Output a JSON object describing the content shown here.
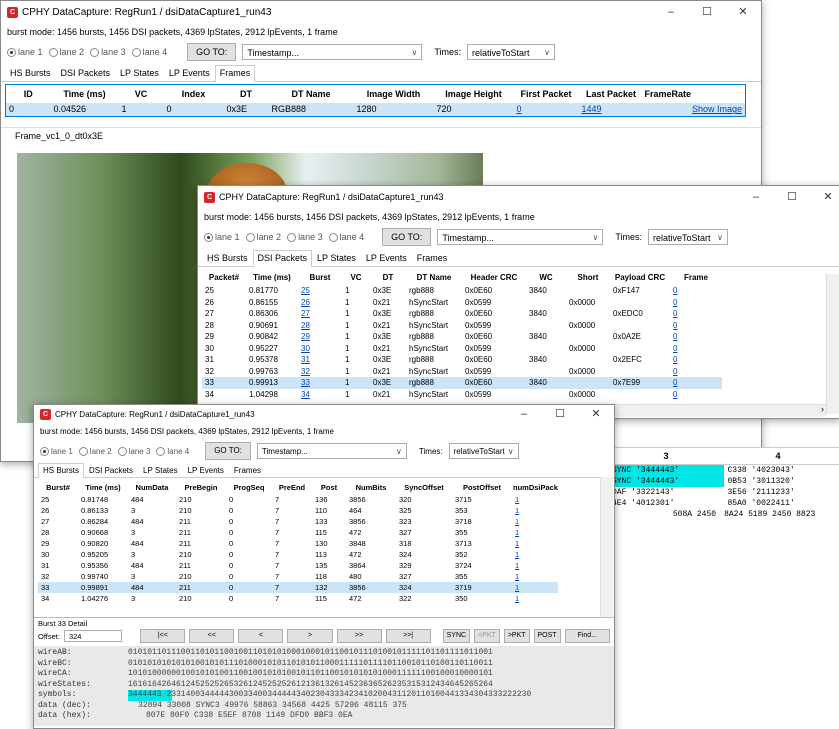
{
  "colors": {
    "accent": "#0078d7",
    "selected_row": "#cce4f7",
    "hex_highlight": "#00e5e5",
    "title_icon": "#d6252c"
  },
  "win1": {
    "title": "CPHY DataCapture: RegRun1 / dsiDataCapture1_run43",
    "summary": "burst mode: 1456 bursts, 1456 DSI packets, 4369 lpStates, 2912 lpEvents, 1 frame",
    "lanes": [
      "lane 1",
      "lane 2",
      "lane 3",
      "lane 4"
    ],
    "goto_label": "GO TO:",
    "goto_value": "Timestamp...",
    "times_label": "Times:",
    "times_value": "relativeToStart",
    "tabs": [
      "HS Bursts",
      "DSI Packets",
      "LP States",
      "LP Events",
      "Frames"
    ],
    "table": {
      "headers": [
        "ID",
        "Time (ms)",
        "VC",
        "Index",
        "DT",
        "DT Name",
        "Image Width",
        "Image Height",
        "First Packet",
        "Last Packet",
        "FrameRate"
      ],
      "row": [
        "0",
        "0.04526",
        "1",
        "0",
        "0x3E",
        "RGB888",
        "1280",
        "720",
        "0",
        "1449",
        ""
      ],
      "show_image": "Show Image"
    },
    "frame_label": "Frame_vc1_0_dt0x3E"
  },
  "win2": {
    "title": "CPHY DataCapture: RegRun1 / dsiDataCapture1_run43",
    "summary": "burst mode: 1456 bursts, 1456 DSI packets, 4369 lpStates, 2912 lpEvents, 1 frame",
    "lanes": [
      "lane 1",
      "lane 2",
      "lane 3",
      "lane 4"
    ],
    "goto_label": "GO TO:",
    "goto_value": "Timestamp...",
    "times_label": "Times:",
    "times_value": "relativeToStart",
    "tabs": [
      "HS Bursts",
      "DSI Packets",
      "LP States",
      "LP Events",
      "Frames"
    ],
    "headers": [
      "Packet#",
      "Time (ms)",
      "Burst",
      "VC",
      "DT",
      "DT Name",
      "Header CRC",
      "WC",
      "Short",
      "Payload CRC",
      "Frame"
    ],
    "rows": [
      [
        "25",
        "0.81770",
        "25",
        "1",
        "0x3E",
        "rgb888",
        "0x0E60",
        "3840",
        "",
        "0xF147",
        "0"
      ],
      [
        "26",
        "0.86155",
        "26",
        "1",
        "0x21",
        "hSyncStart",
        "0x0599",
        "",
        "0x0000",
        "",
        "0"
      ],
      [
        "27",
        "0.86306",
        "27",
        "1",
        "0x3E",
        "rgb888",
        "0x0E60",
        "3840",
        "",
        "0xEDC0",
        "0"
      ],
      [
        "28",
        "0.90691",
        "28",
        "1",
        "0x21",
        "hSyncStart",
        "0x0599",
        "",
        "0x0000",
        "",
        "0"
      ],
      [
        "29",
        "0.90842",
        "29",
        "1",
        "0x3E",
        "rgb888",
        "0x0E60",
        "3840",
        "",
        "0x0A2E",
        "0"
      ],
      [
        "30",
        "0.95227",
        "30",
        "1",
        "0x21",
        "hSyncStart",
        "0x0599",
        "",
        "0x0000",
        "",
        "0"
      ],
      [
        "31",
        "0.95378",
        "31",
        "1",
        "0x3E",
        "rgb888",
        "0x0E60",
        "3840",
        "",
        "0x2EFC",
        "0"
      ],
      [
        "32",
        "0.99763",
        "32",
        "1",
        "0x21",
        "hSyncStart",
        "0x0599",
        "",
        "0x0000",
        "",
        "0"
      ],
      [
        "33",
        "0.99913",
        "33",
        "1",
        "0x3E",
        "rgb888",
        "0x0E60",
        "3840",
        "",
        "0x7E99",
        "0"
      ],
      [
        "34",
        "1.04298",
        "34",
        "1",
        "0x21",
        "hSyncStart",
        "0x0599",
        "",
        "0x0000",
        "",
        "0"
      ]
    ],
    "selected_index": 8
  },
  "win3": {
    "title": "CPHY DataCapture: RegRun1 / dsiDataCapture1_run43",
    "summary": "burst mode: 1456 bursts, 1456 DSI packets, 4369 lpStates, 2912 lpEvents, 1 frame",
    "lanes": [
      "lane 1",
      "lane 2",
      "lane 3",
      "lane 4"
    ],
    "goto_label": "GO TO:",
    "goto_value": "Timestamp...",
    "times_label": "Times:",
    "times_value": "relativeToStart",
    "tabs": [
      "HS Bursts",
      "DSI Packets",
      "LP States",
      "LP Events",
      "Frames"
    ],
    "headers": [
      "Burst#",
      "Time (ms)",
      "NumData",
      "PreBegin",
      "ProgSeq",
      "PreEnd",
      "Post",
      "NumBits",
      "SyncOffset",
      "PostOffset",
      "numDsiPackets"
    ],
    "rows": [
      [
        "25",
        "0.81748",
        "484",
        "210",
        "0",
        "7",
        "136",
        "3856",
        "320",
        "3715",
        "1"
      ],
      [
        "26",
        "0.86133",
        "3",
        "210",
        "0",
        "7",
        "110",
        "464",
        "325",
        "353",
        "1"
      ],
      [
        "27",
        "0.86284",
        "484",
        "211",
        "0",
        "7",
        "133",
        "3856",
        "323",
        "3718",
        "1"
      ],
      [
        "28",
        "0.90668",
        "3",
        "211",
        "0",
        "7",
        "115",
        "472",
        "327",
        "355",
        "1"
      ],
      [
        "29",
        "0.90820",
        "484",
        "211",
        "0",
        "7",
        "130",
        "3848",
        "318",
        "3713",
        "1"
      ],
      [
        "30",
        "0.95205",
        "3",
        "210",
        "0",
        "7",
        "113",
        "472",
        "324",
        "352",
        "1"
      ],
      [
        "31",
        "0.95356",
        "484",
        "211",
        "0",
        "7",
        "135",
        "3864",
        "329",
        "3724",
        "1"
      ],
      [
        "32",
        "0.99740",
        "3",
        "210",
        "0",
        "7",
        "118",
        "480",
        "327",
        "355",
        "1"
      ],
      [
        "33",
        "0.99891",
        "484",
        "211",
        "0",
        "7",
        "132",
        "3856",
        "324",
        "3719",
        "1"
      ],
      [
        "34",
        "1.04276",
        "3",
        "210",
        "0",
        "7",
        "115",
        "472",
        "322",
        "350",
        "1"
      ]
    ],
    "selected_index": 8,
    "detail": {
      "title": "Burst 33 Detail",
      "offset_label": "Offset:",
      "offset_value": "324",
      "nav": [
        "|<<",
        "<<",
        "<",
        ">",
        ">>",
        ">>|"
      ],
      "buttons": [
        "SYNC",
        "<PKT",
        ">PKT",
        "POST",
        "Find..."
      ],
      "labels": [
        "wireAB:",
        "wireBC:",
        "wireCA:",
        "wireStates:",
        "symbols:",
        "data (dec):",
        "data (hex):"
      ],
      "values": [
        "0101011011100110101100100110101010001000101100101110100101111101101111011001",
        "0101010101010100101011101000101011010101100011111011110110010110100110110011",
        "1010100000010010101001100100101010010110110010101010100011111100100010000101",
        "1616164264612452525265326124525252612136132614523636526235315312434645265264",
        "3444443 2331400344444300334003444443402304333423410200431120110100441334304333222230",
        "32894  33008  SYNC3  49976  58863  34568  4425  57296  48115  375",
        "807E   80F0   C338   E5EF   8708   1149   DFD0   BBF3   0EA"
      ]
    }
  },
  "right_panel": {
    "col3": "3",
    "col4": "4",
    "rows": [
      [
        "SYNC '3444443'",
        "C338 '4023043'"
      ],
      [
        "SYNC '3444443'",
        "0B53 '3011320'"
      ],
      [
        "DAF '3322143'",
        "3E56 '2111233'"
      ],
      [
        "4E4 '4012301'",
        "85A0 '0022411'"
      ],
      [
        "508A  2450",
        "8A24  5189  2450  8823"
      ]
    ]
  }
}
